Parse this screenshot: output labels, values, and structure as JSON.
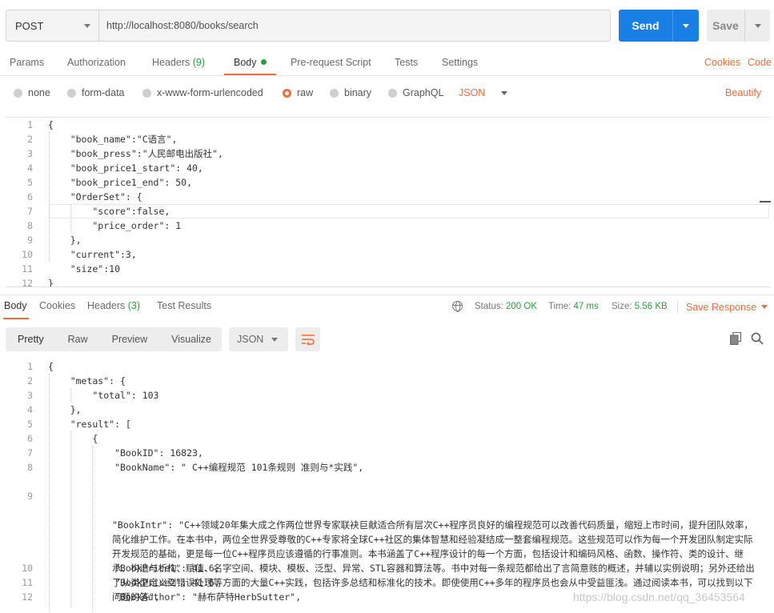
{
  "request": {
    "method": "POST",
    "url": "http://localhost:8080/books/search",
    "send_label": "Send",
    "save_label": "Save"
  },
  "tabs": {
    "params": "Params",
    "authorization": "Authorization",
    "headers": "Headers",
    "headers_count": "(9)",
    "body": "Body",
    "prerequest": "Pre-request Script",
    "tests": "Tests",
    "settings": "Settings",
    "cookies": "Cookies",
    "code": "Code"
  },
  "body_types": {
    "none": "none",
    "form_data": "form-data",
    "urlencoded": "x-www-form-urlencoded",
    "raw": "raw",
    "binary": "binary",
    "graphql": "GraphQL",
    "format": "JSON",
    "beautify": "Beautify"
  },
  "request_body": [
    "{",
    "    \"book_name\":\"C语言\",",
    "    \"book_press\":\"人民邮电出版社\",",
    "    \"book_price1_start\": 40,",
    "    \"book_price1_end\": 50,",
    "    \"OrderSet\": {",
    "        \"score\":false,",
    "        \"price_order\": 1",
    "    },",
    "    \"current\":3,",
    "    \"size\":10",
    "}"
  ],
  "response": {
    "tabs": {
      "body": "Body",
      "cookies": "Cookies",
      "headers": "Headers",
      "headers_count": "(3)",
      "test_results": "Test Results"
    },
    "status_label": "Status:",
    "status_value": "200 OK",
    "time_label": "Time:",
    "time_value": "47 ms",
    "size_label": "Size:",
    "size_value": "5.56 KB",
    "save_response": "Save Response",
    "views": {
      "pretty": "Pretty",
      "raw": "Raw",
      "preview": "Preview",
      "visualize": "Visualize"
    },
    "format": "JSON",
    "lines": [
      "{",
      "    \"metas\": {",
      "        \"total\": 103",
      "    },",
      "    \"result\": [",
      "        {",
      "            \"BookID\": 16823,",
      "            \"BookName\": \" C++编程规范 101条规则 准则与*实践\",",
      "            \"BookIntr\": \"C++领域20年集大成之作两位世界专家联袂巨献适合所有层次C++程序员良好的编程规范可以改善代码质量，缩短上市时间，提升团队效率，简化维护工作。在本书中，两位全世界受尊敬的C++专家将全球C++社区的集体智慧和经验凝结成一整套编程规范。这些规范可以作为每一个开发团队制定实际开发规范的基础，更是每一位C++程序员应该遵循的行事准则。本书涵盖了C++程序设计的每一个方面，包括设计和编码风格、函数、操作符、类的设计、继承、构造与析构、赋值、名字空间、模块、模板、泛型、异常、STL容器和算法等。书中对每一条规范都给出了言简意赅的概述，并辅以实例说明；另外还给出了从类型定义到错误处理等方面的大量C++实践，包括许多总结和标准化的技术。即使使用C++多年的程序员也会从中受益匪浅。通过阅读本书，可以找到以下问题的答\",",
      "            \"BookPrice1\": 41.6,",
      "            \"BookPrice2\": 41.6,",
      "            \"BookAuthor\": \"赫布萨特HerbSutter\","
    ]
  },
  "watermark": "https://blog.csdn.net/qq_36453564"
}
